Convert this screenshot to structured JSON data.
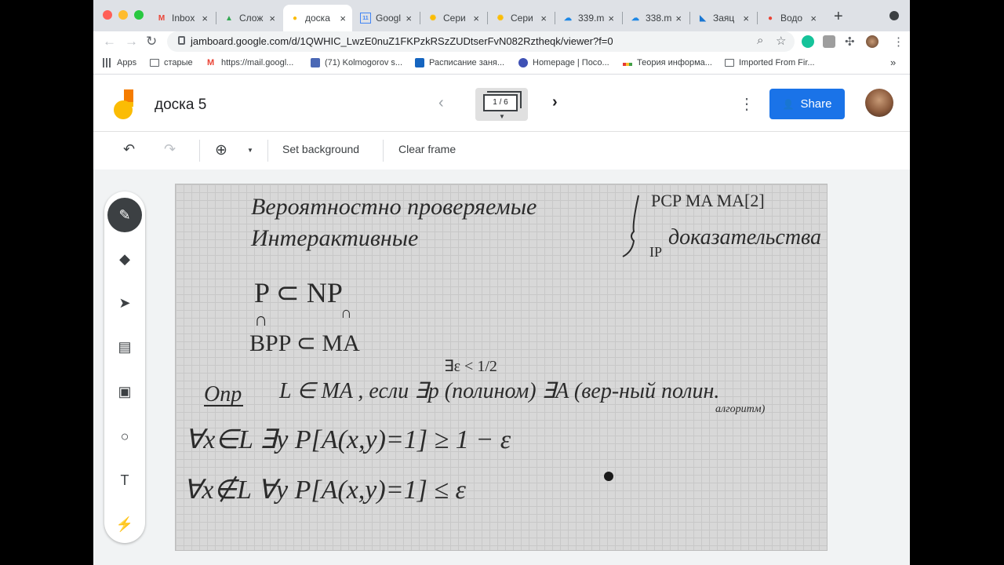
{
  "browser": {
    "tabs": [
      {
        "title": "Inbox",
        "favicon": "gmail-icon",
        "color": "#ea4335"
      },
      {
        "title": "Слож",
        "favicon": "drive-icon",
        "color": "#34a853"
      },
      {
        "title": "доска",
        "favicon": "jamboard-icon",
        "color": "#fbbc04",
        "active": true
      },
      {
        "title": "Googl",
        "favicon": "calendar-icon",
        "color": "#4285f4"
      },
      {
        "title": "Сери",
        "favicon": "jamboard-icon",
        "color": "#fbbc04"
      },
      {
        "title": "Сери",
        "favicon": "jamboard-icon",
        "color": "#fbbc04"
      },
      {
        "title": "339.m",
        "favicon": "cloud-icon",
        "color": "#1e88e5"
      },
      {
        "title": "338.m",
        "favicon": "cloud-icon",
        "color": "#1e88e5"
      },
      {
        "title": "Заяц",
        "favicon": "vote-icon",
        "color": "#1976d2"
      },
      {
        "title": "Водо",
        "favicon": "maps-icon",
        "color": "#ea4335"
      }
    ],
    "close_glyph": "×",
    "newtab_glyph": "+",
    "url": "jamboard.google.com/d/1QWHIC_LwzE0nuZ1FKPzkRSzZUDtserFvN082Rztheqk/viewer?f=0",
    "bookmarks": [
      {
        "label": "Apps",
        "icon": "apps-icon"
      },
      {
        "label": "старые",
        "icon": "folder-icon"
      },
      {
        "label": "https://mail.googl...",
        "icon": "gmail-icon"
      },
      {
        "label": "(71) Kolmogorov s...",
        "icon": "bookmark-icon"
      },
      {
        "label": "Расписание заня...",
        "icon": "calendar-icon"
      },
      {
        "label": "Homepage | Посо...",
        "icon": "globe-icon"
      },
      {
        "label": "Теория информа...",
        "icon": "dots-icon"
      },
      {
        "label": "Imported From Fir...",
        "icon": "folder-icon"
      }
    ],
    "bookmarks_overflow": "»"
  },
  "jamboard": {
    "title": "доска 5",
    "frame_indicator": "1 / 6",
    "share_label": "Share",
    "toolbar": {
      "set_background": "Set background",
      "clear_frame": "Clear frame"
    },
    "tools": [
      "pen-icon",
      "eraser-icon",
      "select-icon",
      "sticky-note-icon",
      "image-icon",
      "circle-icon",
      "textbox-icon",
      "laser-icon"
    ]
  },
  "board_text": {
    "line1": "Вероятностно проверяемые",
    "line2": "Интерактивные",
    "right_top": "PCP MA MA[2]",
    "right_ip": "IP",
    "right_proofs": "доказательства",
    "p_np": "P ⊂ NP",
    "cap1": "∩",
    "cap2": "∩",
    "bpp_ma": "BPP ⊂ MA",
    "eps_cond": "∃ε < 1/2",
    "def_label": "Опр",
    "def_text": "L ∈ MA , если ∃p (полином) ∃A (вер-ный полин.",
    "def_text2": "алгоритм)",
    "forall1": "∀x∈L ∃y P[A(x,y)=1] ≥ 1 − ε",
    "forall2": "∀x∉L ∀y P[A(x,y)=1] ≤ ε"
  },
  "colors": {
    "share_blue": "#1a73e8",
    "ink": "#2b2b2b"
  }
}
